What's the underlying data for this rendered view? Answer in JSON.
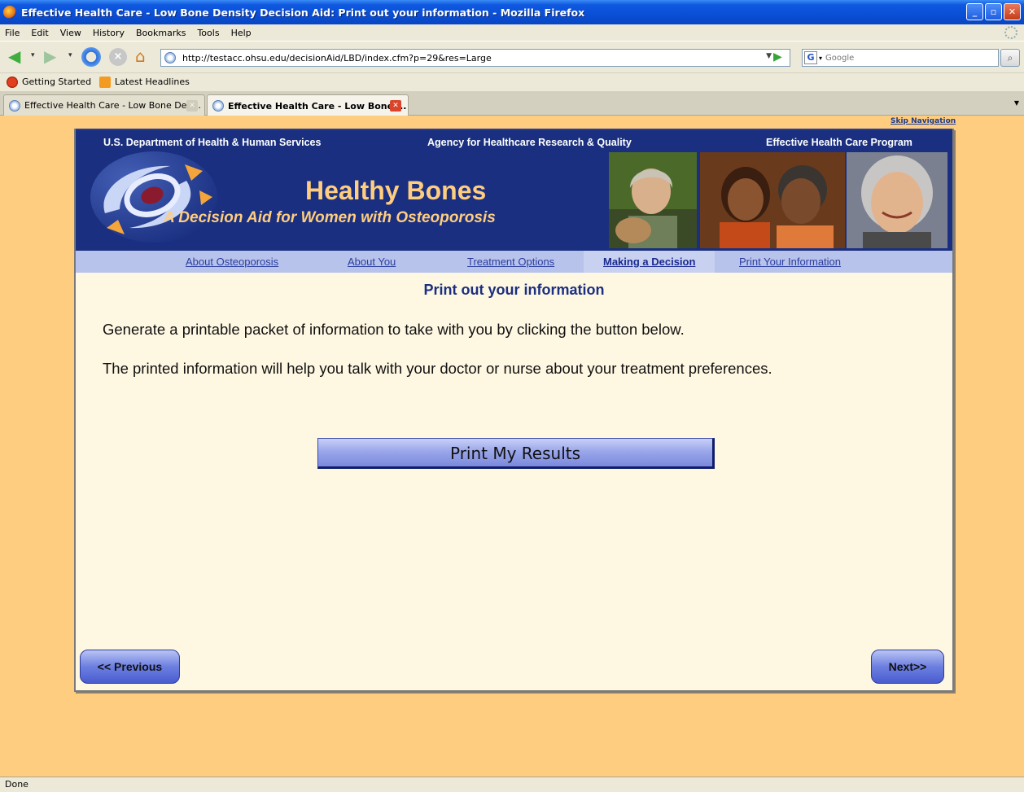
{
  "window": {
    "title": "Effective Health Care - Low Bone Density Decision Aid: Print out your information - Mozilla Firefox",
    "minimize": "_",
    "maximize": "▫",
    "close": "✕"
  },
  "menu": [
    "File",
    "Edit",
    "View",
    "History",
    "Bookmarks",
    "Tools",
    "Help"
  ],
  "toolbar": {
    "url": "http://testacc.ohsu.edu/decisionAid/LBD/index.cfm?p=29&res=Large",
    "search_engine": "G",
    "search_placeholder": "Google"
  },
  "bookmarks": [
    "Getting Started",
    "Latest Headlines"
  ],
  "tabs": [
    {
      "label": "Effective Health Care - Low Bone Den..."
    },
    {
      "label": "Effective Health Care - Low Bone ..."
    }
  ],
  "page": {
    "skip_nav": "Skip Navigation",
    "header": {
      "left": "U.S. Department of Health & Human Services",
      "center": "Agency for Healthcare Research & Quality",
      "right": "Effective Health Care Program"
    },
    "title": "Healthy Bones",
    "subtitle": "A Decision Aid for Women with Osteoporosis",
    "nav": [
      "About Osteoporosis",
      "About You",
      "Treatment Options",
      "Making a Decision",
      "Print Your Information"
    ],
    "nav_current_index": 3,
    "content_title": "Print out your information",
    "paragraphs": [
      "Generate a printable packet of information to take with you by clicking the button below.",
      "The printed information will help you talk with your doctor or nurse about your treatment preferences."
    ],
    "print_button": "Print My Results",
    "prev_button": "<< Previous",
    "next_button": "Next>>"
  },
  "status": "Done",
  "colors": {
    "banner": "#1a2f80",
    "title_gold": "#ffcd7f",
    "page_bg": "#ffcd7f",
    "content_bg": "#fef7e2",
    "nav_strip": "#b7c3ea"
  }
}
